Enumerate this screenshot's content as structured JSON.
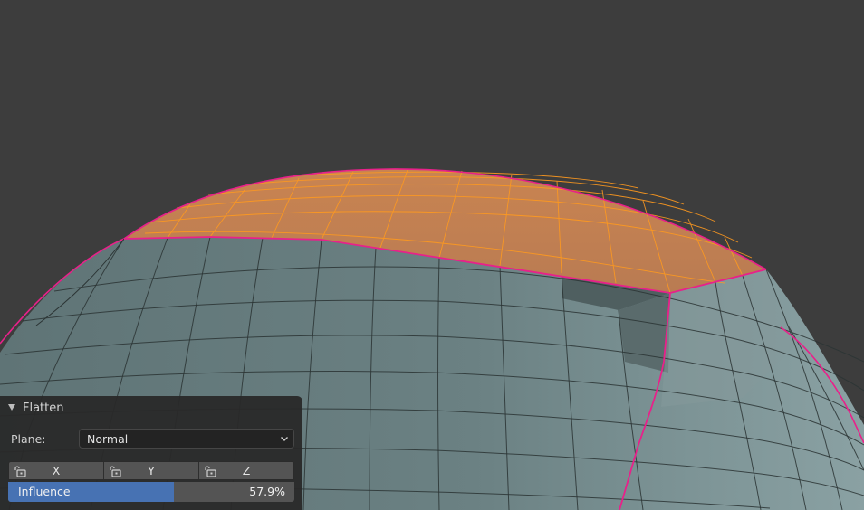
{
  "viewport": {
    "background_color": "#3d3d3d",
    "mesh_color": "#6f8486",
    "selected_face_color": "#d18a55",
    "selected_edge_color": "#ff9a1f",
    "seam_color": "#e8218a",
    "wire_color": "#2a3333"
  },
  "panel": {
    "title": "Flatten",
    "collapse_icon": "triangle-down-icon",
    "plane_label": "Plane:",
    "plane_value": "Normal",
    "axes": [
      {
        "label": "X",
        "lock_icon": "padlock-icon"
      },
      {
        "label": "Y",
        "lock_icon": "padlock-icon"
      },
      {
        "label": "Z",
        "lock_icon": "padlock-icon"
      }
    ],
    "influence_label": "Influence",
    "influence_value": "57.9%",
    "influence_fraction": 0.579,
    "influence_color": "#4772b3"
  }
}
